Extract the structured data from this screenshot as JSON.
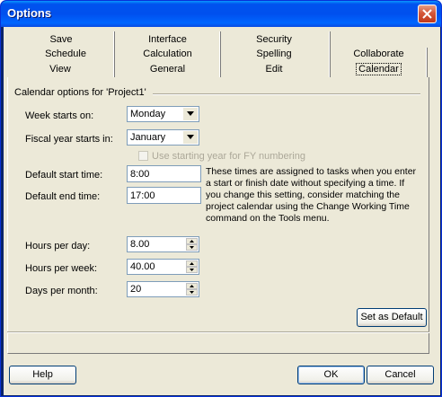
{
  "window": {
    "title": "Options"
  },
  "tabs": {
    "row1": [
      {
        "label": "Save"
      },
      {
        "label": "Interface"
      },
      {
        "label": "Security"
      }
    ],
    "row2": [
      {
        "label": "Schedule"
      },
      {
        "label": "Calculation"
      },
      {
        "label": "Spelling"
      },
      {
        "label": "Collaborate"
      }
    ],
    "row3": [
      {
        "label": "View"
      },
      {
        "label": "General"
      },
      {
        "label": "Edit"
      },
      {
        "label": "Calendar",
        "active": true
      }
    ]
  },
  "calendar": {
    "group_label": "Calendar options for 'Project1'",
    "week_starts_label": "Week starts on:",
    "week_starts_value": "Monday",
    "fiscal_year_label": "Fiscal year starts in:",
    "fiscal_year_value": "January",
    "fy_numbering_label": "Use starting year for FY numbering",
    "fy_numbering_checked": false,
    "default_start_label": "Default start time:",
    "default_start_value": "8:00",
    "default_end_label": "Default end time:",
    "default_end_value": "17:00",
    "note": "These times are assigned to tasks when you enter a start or finish date without specifying a time. If you change this setting, consider matching the project calendar using the Change Working Time command on the Tools menu.",
    "hours_day_label": "Hours per day:",
    "hours_day_value": "8.00",
    "hours_week_label": "Hours per week:",
    "hours_week_value": "40.00",
    "days_month_label": "Days per month:",
    "days_month_value": "20",
    "set_default_label": "Set as Default"
  },
  "footer": {
    "help_label": "Help",
    "ok_label": "OK",
    "cancel_label": "Cancel"
  }
}
